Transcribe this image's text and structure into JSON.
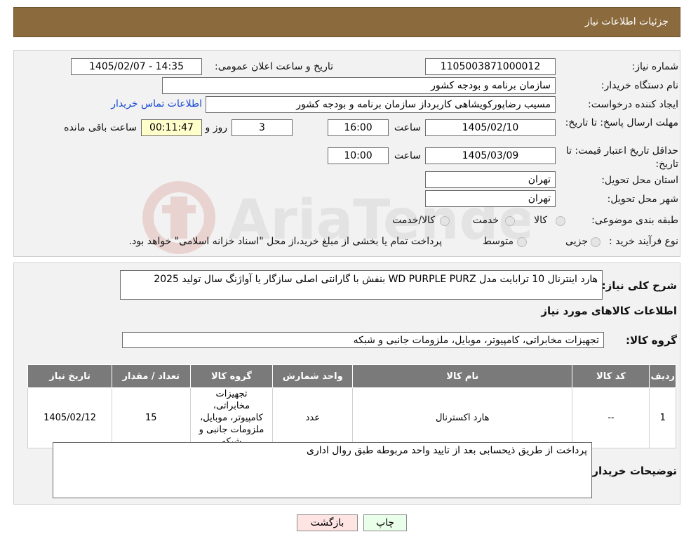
{
  "header": {
    "title": "جزئیات اطلاعات نیاز"
  },
  "form": {
    "need_number_label": "شماره نیاز:",
    "need_number": "1105003871000012",
    "announce_label": "تاریخ و ساعت اعلان عمومی:",
    "announce_value": "1405/02/07 - 14:35",
    "buyer_org_label": "نام دستگاه خریدار:",
    "buyer_org": "سازمان برنامه و بودجه کشور",
    "requester_label": "ایجاد کننده درخواست:",
    "requester": "مسیب رضاپورکویشاهی کاربرداز سازمان برنامه و بودجه کشور",
    "buyer_contact_link": "اطلاعات تماس خریدار",
    "deadline_label": "مهلت ارسال پاسخ: تا تاریخ:",
    "deadline_date": "1405/02/10",
    "time_label": "ساعت",
    "deadline_time": "16:00",
    "days_value": "3",
    "days_label": "روز و",
    "remaining_time": "00:11:47",
    "remaining_label": "ساعت باقی مانده",
    "validity_label": "حداقل تاریخ اعتبار قیمت: تا تاریخ:",
    "validity_date": "1405/03/09",
    "validity_time": "10:00",
    "province_label": "استان محل تحویل:",
    "province": "تهران",
    "city_label": "شهر محل تحویل:",
    "city": "تهران",
    "category_label": "طبقه بندی موضوعی:",
    "category_options": [
      "کالا",
      "خدمت",
      "کالا/خدمت"
    ],
    "process_label": "نوع فرآیند خرید :",
    "process_options": [
      "جزیی",
      "متوسط"
    ],
    "process_note": "پرداخت تمام یا بخشی از مبلغ خرید،از محل \"اسناد خزانه اسلامی\" خواهد بود."
  },
  "details": {
    "description_label": "شرح کلی نیاز:",
    "description": "هارد اینترنال 10 ترابایت مدل WD PURPLE PURZ بنفش با گارانتی اصلی سازگار یا آواژنگ سال تولید 2025",
    "goods_info_title": "اطلاعات کالاهای مورد نیاز",
    "goods_group_label": "گروه کالا:",
    "goods_group": "تجهیزات مخابراتی، کامپیوتر، موبایل، ملزومات جانبی و شبکه",
    "table": {
      "headers": [
        "ردیف",
        "کد کالا",
        "نام کالا",
        "واحد شمارش",
        "گروه کالا",
        "تعداد / مقدار",
        "تاریخ نیاز"
      ],
      "rows": [
        [
          "1",
          "--",
          "هارد اکسترنال",
          "عدد",
          "تجهیزات مخابراتی، کامپیوتر، موبایل، ملزومات جانبی و شبکه",
          "15",
          "1405/02/12"
        ]
      ]
    },
    "buyer_notes_label": "توضیحات خریدار:",
    "buyer_notes": "پرداخت از طریق ذیحسابی بعد از تایید واحد مربوطه طبق روال اداری"
  },
  "buttons": {
    "print": "چاپ",
    "back": "بازگشت"
  },
  "watermark_text": "AriaTender.neT",
  "colors": {
    "header_bg": "#8b6a3d",
    "table_header": "#7a7a7a",
    "link": "#1a4bd6",
    "print_btn": "#eaffea",
    "back_btn": "#ffe4e4"
  }
}
